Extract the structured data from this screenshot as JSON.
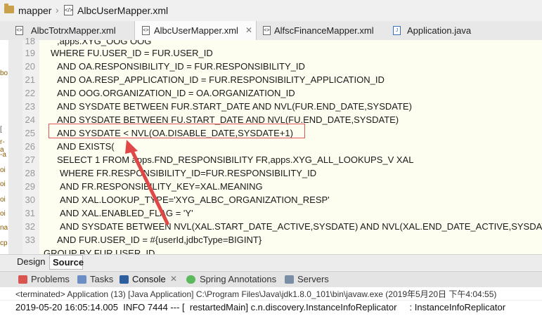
{
  "breadcrumb": {
    "folder": "mapper",
    "file": "AlbcUserMapper.xml"
  },
  "tabs": [
    {
      "label": "AlbcTotrxMapper.xml",
      "active": false
    },
    {
      "label": "AlbcUserMapper.xml",
      "active": true
    },
    {
      "label": "AlfscFinanceMapper.xml",
      "active": false
    },
    {
      "label": "Application.java",
      "active": false
    }
  ],
  "left_fragments": [
    "bo",
    "[",
    "r-a",
    "-a",
    "oi",
    "oi",
    "oi",
    "oi",
    "na",
    "cp",
    "rp"
  ],
  "code": {
    "line_numbers": [
      "18",
      "19",
      "20",
      "21",
      "22",
      "23",
      "24",
      "25",
      "26",
      "27",
      "28",
      "29",
      "30",
      "31",
      "32",
      "33"
    ],
    "top_partial": ",apps.XYG_OOG OOG",
    "lines": [
      "WHERE FU.USER_ID = FUR.USER_ID",
      "AND OA.RESPONSIBILITY_ID = FUR.RESPONSIBILITY_ID",
      "AND OA.RESP_APPLICATION_ID = FUR.RESPONSIBILITY_APPLICATION_ID",
      "AND OOG.ORGANIZATION_ID = OA.ORGANIZATION_ID",
      "AND SYSDATE BETWEEN FUR.START_DATE AND NVL(FUR.END_DATE,SYSDATE)",
      "AND SYSDATE BETWEEN FU.START_DATE AND NVL(FU.END_DATE,SYSDATE)",
      "AND SYSDATE < NVL(OA.DISABLE_DATE,SYSDATE+1)",
      "AND EXISTS(",
      "SELECT 1 FROM apps.FND_RESPONSIBILITY FR,apps.XYG_ALL_LOOKUPS_V XAL",
      "WHERE FR.RESPONSIBILITY_ID=FUR.RESPONSIBILITY_ID",
      "AND FR.RESPONSIBILITY_KEY=XAL.MEANING",
      "AND XAL.LOOKUP_TYPE='XYG_ALBC_ORGANIZATION_RESP'",
      "AND XAL.ENABLED_FLAG = 'Y'",
      "AND SYSDATE BETWEEN NVL(XAL.START_DATE_ACTIVE,SYSDATE) AND NVL(XAL.END_DATE_ACTIVE,SYSDATE)",
      "AND FUR.USER_ID = #{userId,jdbcType=BIGINT}"
    ],
    "bottom_partial": "GROUP BY FUR.USER_ID"
  },
  "editor_tabs": {
    "design": "Design",
    "source": "Source"
  },
  "panel_tabs": [
    "Problems",
    "Tasks",
    "Console",
    "Spring Annotations",
    "Servers"
  ],
  "status_line": "<terminated> Application (13) [Java Application] C:\\Program Files\\Java\\jdk1.8.0_101\\bin\\javaw.exe (2019年5月20日 下午4:04:55)",
  "console_line": "2019-05-20 16:05:14.005  INFO 7444 --- [  restartedMain] c.n.discovery.InstanceInfoReplicator     : InstanceInfoReplicator",
  "colors": {
    "highlight_box": "#e05555",
    "arrow": "#e04848",
    "code_bg": "#fdfdf0",
    "change_stripe": "#c8ecc8"
  }
}
